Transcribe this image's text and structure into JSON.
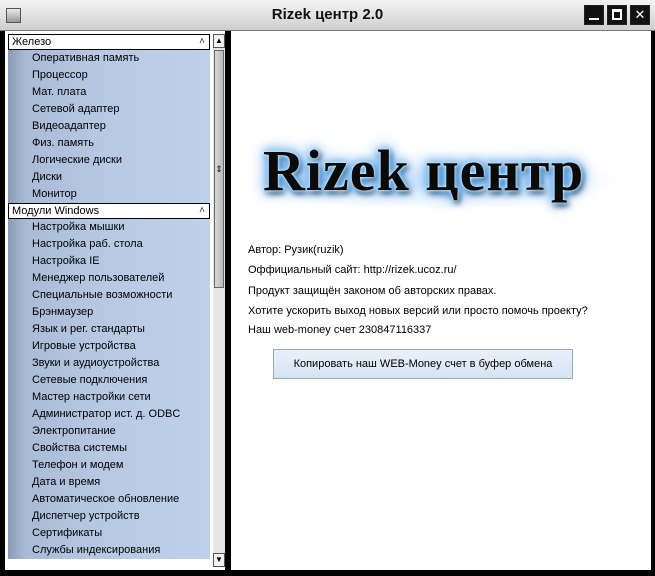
{
  "window": {
    "title": "Rizek центр 2.0",
    "controls": {
      "minimize": "_",
      "maximize": "□",
      "close": "✕"
    }
  },
  "sidebar": {
    "groups": [
      {
        "title": "Железо",
        "items": [
          "Оперативная память",
          "Процессор",
          "Мат. плата",
          "Сетевой адаптер",
          "Видеоадаптер",
          "Физ. память",
          "Логические диски",
          "Диски",
          "Монитор"
        ]
      },
      {
        "title": "Модули Windows",
        "items": [
          "Настройка мышки",
          "Настройка раб. стола",
          "Настройка IE",
          "Менеджер пользователей",
          "Специальные возможности",
          "Брэнмаузер",
          "Язык и рег. стандарты",
          "Игровые устройства",
          "Звуки и аудиоустройства",
          "Сетевые подключения",
          "Мастер настройки сети",
          "Администратор ист. д. ODBC",
          "Электропитание",
          "Свойства системы",
          "Телефон и модем",
          "Дата и время",
          "Автоматическое обновление",
          "Диспетчер устройств",
          "Сертификаты",
          "Службы индексирования"
        ]
      }
    ],
    "scrollbar": {
      "up": "▲",
      "down": "▼",
      "thumb": "⇕"
    },
    "group_chevron": "˄"
  },
  "main": {
    "logo_text": "Rizek центр",
    "author": "Автор: Рузик(ruzik)",
    "site": "Оффициальный сайт: http://rizek.ucoz.ru/",
    "copyright": "Продукт защищён законом об авторских правах.",
    "help": "Хотите ускорить выход новых версий или просто помочь проекту?",
    "webmoney": "Наш web-money счет 230847116337",
    "copy_button": "Копировать наш WEB-Money счет в буфер обмена"
  }
}
